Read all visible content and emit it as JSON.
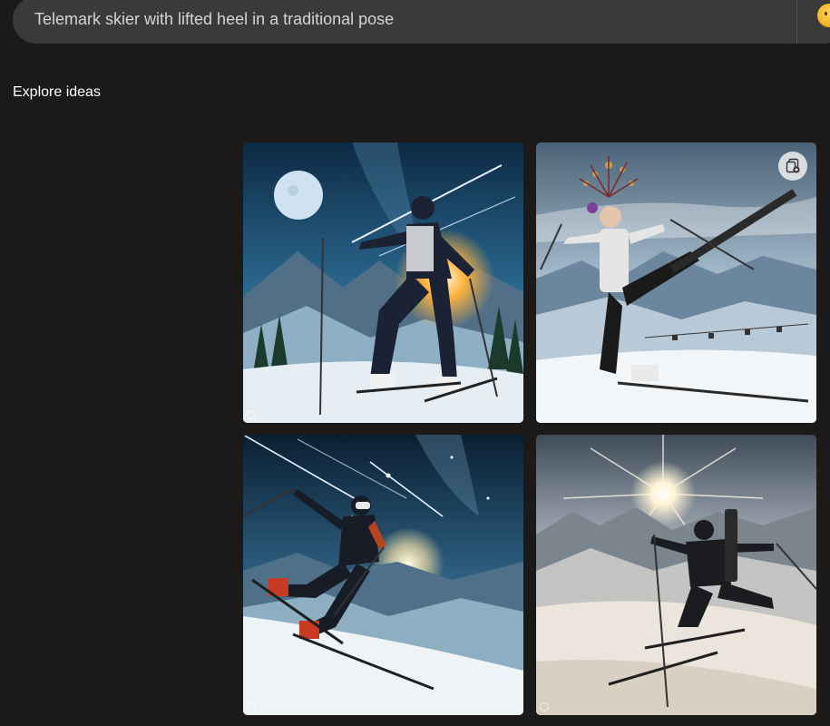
{
  "search": {
    "query": "Telemark skier with lifted heel in a traditional pose"
  },
  "explore": {
    "title": "Explore ideas"
  },
  "icons": {
    "emoji": "emoji-face-icon",
    "save": "add-to-collection-icon",
    "watermark": "ai-watermark-icon"
  },
  "colors": {
    "background": "#1b1a19",
    "search_bar": "#3b3a39",
    "text_primary": "#ffffff",
    "text_search": "#d6d4d2"
  },
  "images": [
    {
      "scene": "night-moon"
    },
    {
      "scene": "day-ornate"
    },
    {
      "scene": "night-stars"
    },
    {
      "scene": "sunburst"
    }
  ]
}
